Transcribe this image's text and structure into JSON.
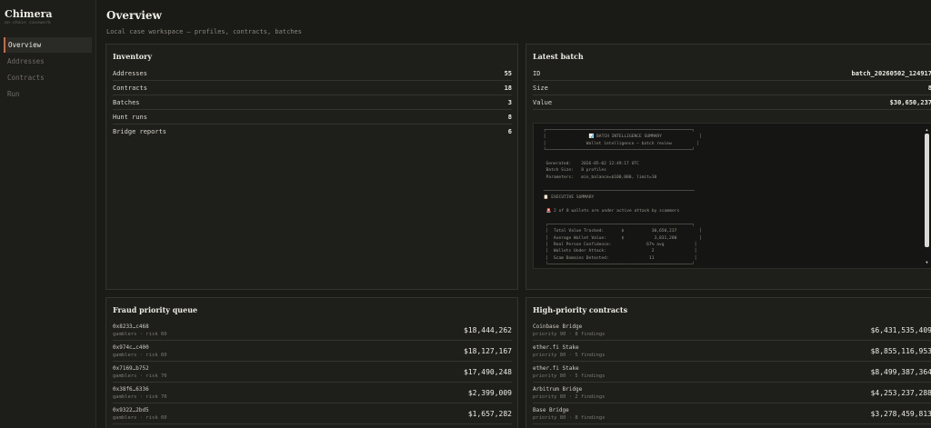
{
  "sidebar": {
    "brand": "Chimera",
    "brand_sub": "on-chain casework",
    "items": [
      {
        "label": "Overview",
        "active": true
      },
      {
        "label": "Addresses"
      },
      {
        "label": "Contracts"
      },
      {
        "label": "Run"
      }
    ]
  },
  "header": {
    "title": "Overview",
    "subtitle": "Local case workspace — profiles, contracts, batches"
  },
  "inventory": {
    "title": "Inventory",
    "rows": [
      {
        "label": "Addresses",
        "value": "55"
      },
      {
        "label": "Contracts",
        "value": "18"
      },
      {
        "label": "Batches",
        "value": "3"
      },
      {
        "label": "Hunt runs",
        "value": "8"
      },
      {
        "label": "Bridge reports",
        "value": "6"
      }
    ]
  },
  "latest_batch": {
    "title": "Latest batch",
    "rows": [
      {
        "label": "ID",
        "value": "batch_20260502_124917"
      },
      {
        "label": "Size",
        "value": "8"
      },
      {
        "label": "Value",
        "value": "$30,650,237"
      }
    ],
    "report_text": " ┌──────────────────────────────────────────────────────────┐\n │                 📊 BATCH INTELLIGENCE SUMMARY               │\n │                Wallet intelligence — batch review          │\n └──────────────────────────────────────────────────────────┘\n\n  Generated:    2026-05-02 12:49:17 UTC\n  Batch Size:   8 profiles\n  Parameters:   min_balance=$100,000, limit=10\n\n ────────────────────────────────────────────────────────────\n 📋 EXECUTIVE SUMMARY\n\n  🚨 2 of 8 wallets are under active attack by scammers\n\n  ┌─────────────────────────────────────────────────────────┐\n  │  Total Value Tracked:       $           30,650,237         │\n  │  Average Wallet Value:      $            3,831,280         │\n  │  Real Person Confidence:              67% avg            │\n  │  Wallets Under Attack:                  2                │\n  │  Scam Domains Detected:                11                │\n  └─────────────────────────────────────────────────────────┘"
  },
  "fraud_queue": {
    "title": "Fraud priority queue",
    "rows": [
      {
        "addr": "0x8233…c468",
        "meta": "gamblers · risk 60",
        "amount": "$18,444,262"
      },
      {
        "addr": "0x974c…c400",
        "meta": "gamblers · risk 60",
        "amount": "$18,127,167"
      },
      {
        "addr": "0x7169…b752",
        "meta": "gamblers · risk 70",
        "amount": "$17,490,248"
      },
      {
        "addr": "0x38f6…6336",
        "meta": "gamblers · risk 70",
        "amount": "$2,399,009"
      },
      {
        "addr": "0x9322…2bd5",
        "meta": "gamblers · risk 60",
        "amount": "$1,657,282"
      }
    ]
  },
  "contracts": {
    "title": "High-priority contracts",
    "rows": [
      {
        "name": "Coinbase Bridge",
        "meta": "priority 90 · 8 findings",
        "amount": "$6,431,535,409"
      },
      {
        "name": "ether.fi Stake",
        "meta": "priority 80 · 5 findings",
        "amount": "$8,855,116,953"
      },
      {
        "name": "ether.fi Stake",
        "meta": "priority 80 · 5 findings",
        "amount": "$8,499,387,364"
      },
      {
        "name": "Arbitrum Bridge",
        "meta": "priority 80 · 2 findings",
        "amount": "$4,253,237,288"
      },
      {
        "name": "Base Bridge",
        "meta": "priority 80 · 8 findings",
        "amount": "$3,278,459,813"
      }
    ]
  }
}
